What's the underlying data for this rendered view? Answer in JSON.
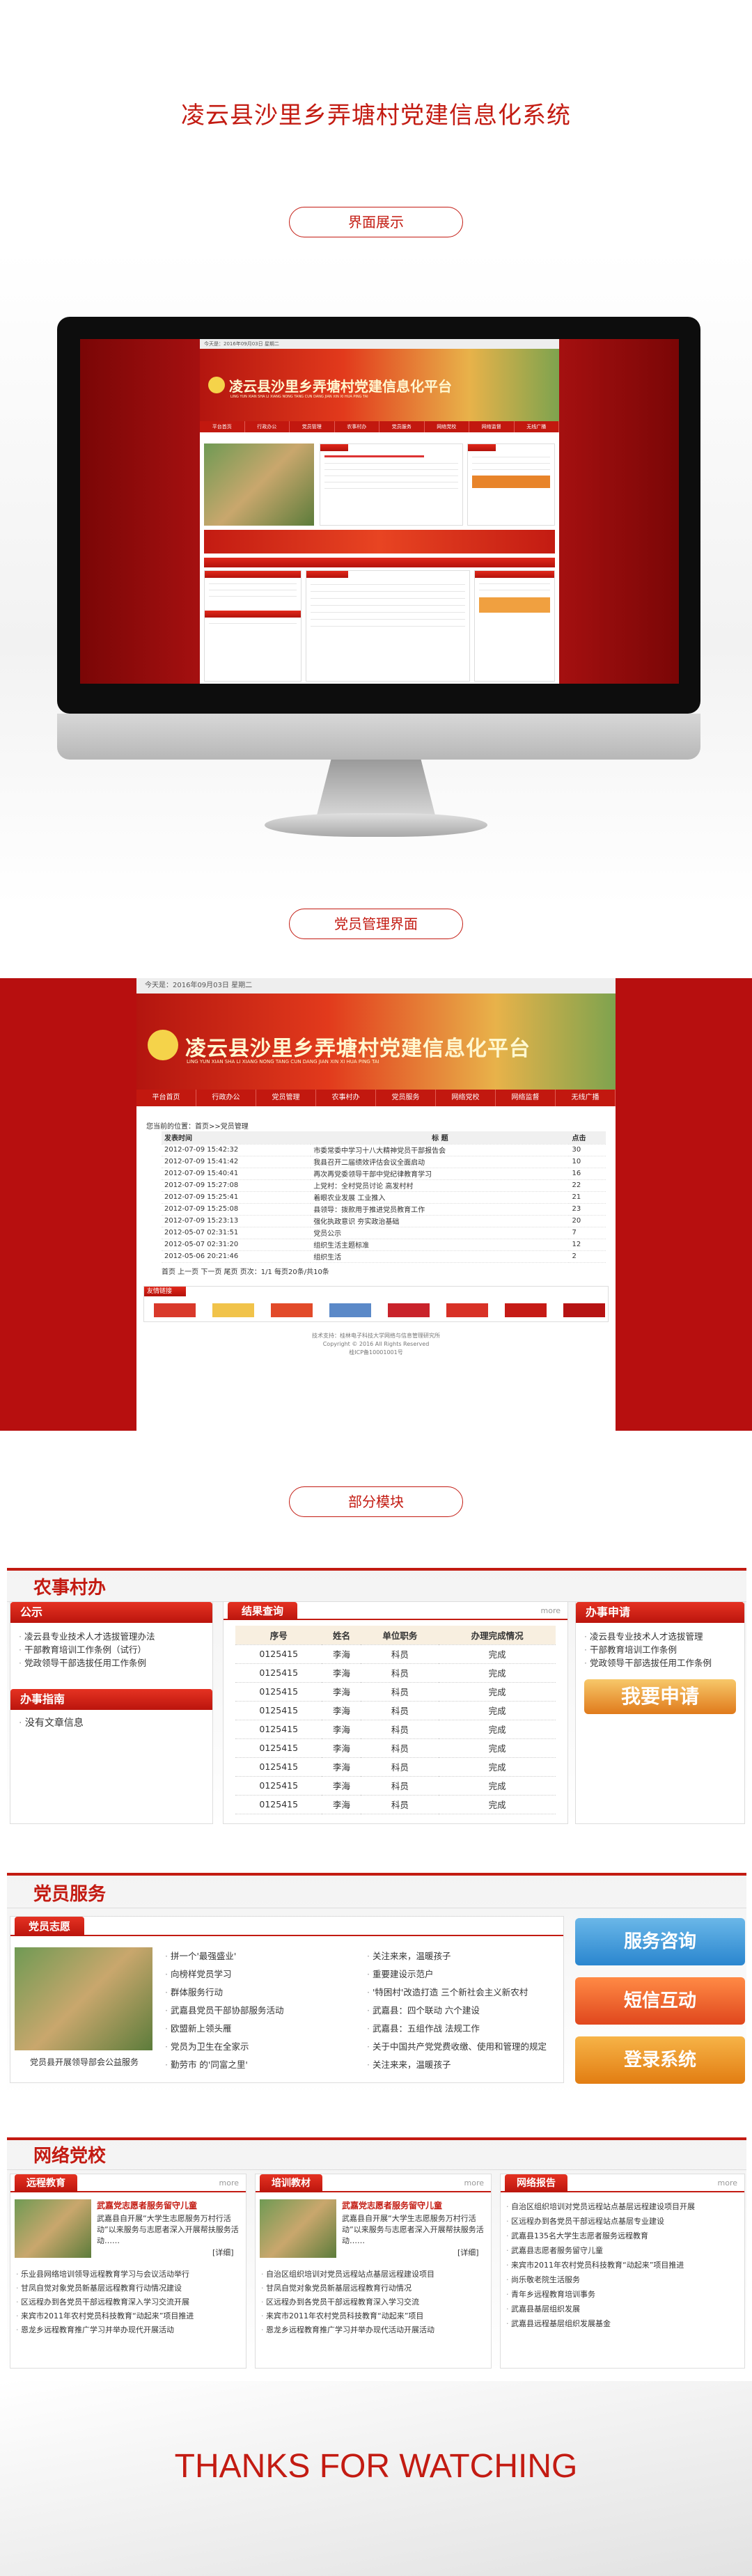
{
  "page": {
    "title": "凌云县沙里乡弄塘村党建信息化系统",
    "sections": [
      "界面展示",
      "党员管理界面",
      "部分模块"
    ],
    "thanks": "THANKS FOR WATCHING"
  },
  "site": {
    "date": "今天是：2016年09月03日 星期二",
    "logo": "凌云县沙里乡弄塘村党建信息化平台",
    "logo_pinyin": "LING YUN XIAN SHA LI XIANG NONG TANG CUN DANG JIAN XIN XI HUA PING TAI",
    "nav": [
      "平台首页",
      "行政办公",
      "党员管理",
      "农事村办",
      "党员服务",
      "网络党校",
      "网络监督",
      "无线广播"
    ]
  },
  "mgmt": {
    "breadcrumb": "您当前的位置：首页>>党员管理",
    "columns": [
      "发表时间",
      "标 题",
      "点击"
    ],
    "rows": [
      {
        "time": "2012-07-09 15:42:32",
        "title": "市委常委中学习十八大精神党员干部报告会",
        "hits": "30"
      },
      {
        "time": "2012-07-09 15:41:42",
        "title": "我县召开二届绩效评估会议全面启动",
        "hits": "10"
      },
      {
        "time": "2012-07-09 15:40:41",
        "title": "再次再党委领导干部中党纪律教育学习",
        "hits": "16"
      },
      {
        "time": "2012-07-09 15:27:08",
        "title": "上党村：全村党员讨论 高发村村",
        "hits": "22"
      },
      {
        "time": "2012-07-09 15:25:41",
        "title": "着眼农业发展 工业推入",
        "hits": "21"
      },
      {
        "time": "2012-07-09 15:25:08",
        "title": "县领导：拨款用于推进党员教育工作",
        "hits": "23"
      },
      {
        "time": "2012-07-09 15:23:13",
        "title": "强化执政意识 夯实政治基础",
        "hits": "20"
      },
      {
        "time": "2012-05-07 02:31:51",
        "title": "党员公示",
        "hits": "7"
      },
      {
        "time": "2012-05-07 02:31:20",
        "title": "组织生活主题标准",
        "hits": "12"
      },
      {
        "time": "2012-05-06 20:21:46",
        "title": "组织生活",
        "hits": "2"
      }
    ],
    "pager": "首页 上一页 下一页 尾页 页次：1/1 每页20条/共10条",
    "friend_links": "友情链接",
    "footer1": "技术支持：桂林电子科技大学网络与信息管理研究所",
    "footer2": "Copyright © 2016 All Rights Reserved",
    "footer3": "桂ICP备10001001号"
  },
  "nongshi": {
    "header": "农事村办",
    "gongshi": "公示",
    "gongshi_items": [
      "凌云县专业技术人才选拔管理办法",
      "干部教育培训工作条例（试行）",
      "党政领导干部选拔任用工作条例"
    ],
    "banshi_zhinan": "办事指南",
    "banshi_empty": "没有文章信息",
    "jieguo": "结果查询",
    "more": "more",
    "columns": [
      "序号",
      "姓名",
      "单位职务",
      "办理完成情况"
    ],
    "rows": [
      [
        "0125415",
        "李海",
        "科员",
        "完成"
      ],
      [
        "0125415",
        "李海",
        "科员",
        "完成"
      ],
      [
        "0125415",
        "李海",
        "科员",
        "完成"
      ],
      [
        "0125415",
        "李海",
        "科员",
        "完成"
      ],
      [
        "0125415",
        "李海",
        "科员",
        "完成"
      ],
      [
        "0125415",
        "李海",
        "科员",
        "完成"
      ],
      [
        "0125415",
        "李海",
        "科员",
        "完成"
      ],
      [
        "0125415",
        "李海",
        "科员",
        "完成"
      ],
      [
        "0125415",
        "李海",
        "科员",
        "完成"
      ]
    ],
    "shenqing": "办事申请",
    "shenqing_items": [
      "凌云县专业技术人才选拔管理",
      "干部教育培训工作条例",
      "党政领导干部选拔任用工作条例"
    ],
    "apply_btn": "我要申请"
  },
  "dangyuan": {
    "header": "党员服务",
    "zhiyuan": "党员志愿",
    "caption": "党员县开展领导部会公益服务",
    "col1": [
      "拼一个'最强盛业'",
      "向榜样党员学习",
      "群体服务行动",
      "武嘉县党员干部协部服务活动",
      "欧盟新上领头雁",
      "党员为卫生在全家示",
      "勤劳市 的'同富之里'"
    ],
    "col2": [
      "关注来来，温暖孩子",
      "重要建设示范户",
      "'特困村'改造打造 三个新社会主义新农村",
      "武嘉县：四个联动 六个建设",
      "武嘉县：五组作战 法规工作",
      "关于中国共产党党费收缴、使用和管理的规定",
      "关注来来，温暖孩子"
    ],
    "btn1": "服务咨询",
    "btn2": "短信互动",
    "btn3": "登录系统"
  },
  "dangxiao": {
    "header": "网络党校",
    "tabs": [
      "远程教育",
      "培训教材",
      "网络报告"
    ],
    "more": "more",
    "headline": "武嘉党志愿者服务留守儿童",
    "blurb": "武嘉县自开展“大学生志愿服务万村行活动”以来服务与志愿者深入开展帮扶服务活动……",
    "detail": "[详细]",
    "list1": [
      "乐业县网络培训领导远程教育学习与会议活动举行",
      "甘凤自觉对象党员新基层远程教育行动情况建设",
      "区远程办到各党员干部远程教育深入学习交流开展",
      "来宾市2011年农村党员科技教育“动起来”项目推进",
      "恩龙乡远程教育推广学习并举办现代开展活动"
    ],
    "list2": [
      "自治区组织培训对党员远程站点基层远程建设项目",
      "甘凤自觉对象党员新基层远程教育行动情况",
      "区远程办到各党员干部远程教育深入学习交流",
      "来宾市2011年农村党员科技教育“动起来”项目",
      "恩龙乡远程教育推广学习并举办现代活动开展活动"
    ],
    "list3": [
      "自治区组织培训对党员远程站点基层远程建设项目开展",
      "区远程办到各党员干部远程站点基层专业建设",
      "武嘉县135名大学生志愿者服务远程教育",
      "武嘉县志愿者服务留守儿童",
      "来宾市2011年农村党员科技教育“动起来”项目推进",
      "尚乐敬老院生活服务",
      "青年乡远程教育培训事务",
      "武嘉县基层组织发展",
      "武嘉县远程基层组织发展基金"
    ]
  },
  "colors": {
    "brand_red": "#c31b12",
    "dark_red": "#b70f0f"
  }
}
